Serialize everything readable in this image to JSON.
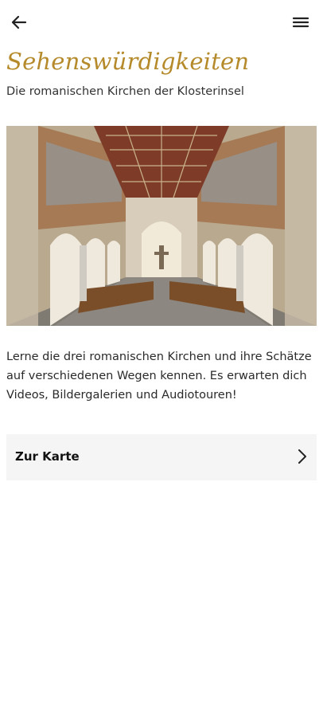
{
  "header": {
    "back_icon": "arrow-left-icon",
    "menu_icon": "hamburger-menu-icon"
  },
  "page": {
    "title": "Sehenswürdigkeiten",
    "subtitle": "Die romanischen Kirchen der Klosterinsel",
    "image_alt": "Church interior nave photo",
    "description": "Lerne die drei romanischen Kirchen und ihre Schätze auf verschiedenen Wegen kennen. Es erwarten dich Videos, Bildergalerien und Audiotouren!"
  },
  "map_link": {
    "label": "Zur Karte",
    "icon": "chevron-right-icon"
  },
  "colors": {
    "title": "#b58a2a",
    "card_bg": "#f5f5f5"
  }
}
